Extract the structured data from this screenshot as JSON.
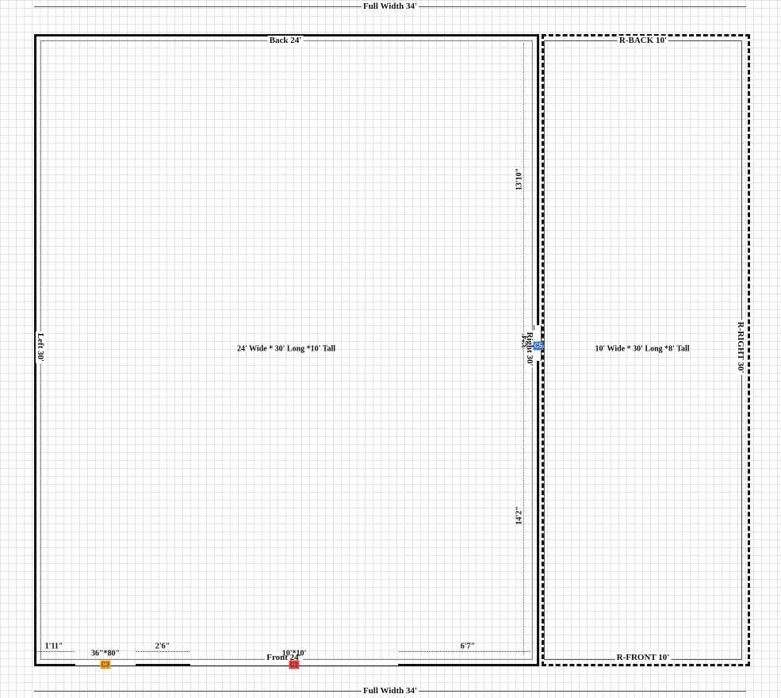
{
  "dimensions": {
    "full_width_top": "Full Width 34'",
    "full_width_bottom": "Full Width 34'"
  },
  "main_building": {
    "back": "Back 24'",
    "front": "Front 24'",
    "left": "Left 30'",
    "right": "Right 30'",
    "description": "24' Wide * 30' Long *10' Tall",
    "right_upper_offset": "13'10\"",
    "right_lower_offset": "14'2\""
  },
  "lean_to": {
    "back": "R-BACK 10'",
    "front": "R-FRONT 10'",
    "right": "R-RIGHT 30'",
    "description": "10' Wide * 30' Long *8' Tall"
  },
  "openings": {
    "door_c3": {
      "id": "C3",
      "size": "36\"*80\"",
      "color": "#f0a020"
    },
    "door_c1": {
      "id": "C1",
      "size": "10'*10'",
      "color": "#e04848"
    },
    "window_c5": {
      "id": "C5",
      "size": "3'*4'",
      "color": "#3a78c0"
    }
  },
  "front_offsets": {
    "left_edge": "1'11\"",
    "between_doors": "2'6\"",
    "right_edge": "6'7\""
  }
}
